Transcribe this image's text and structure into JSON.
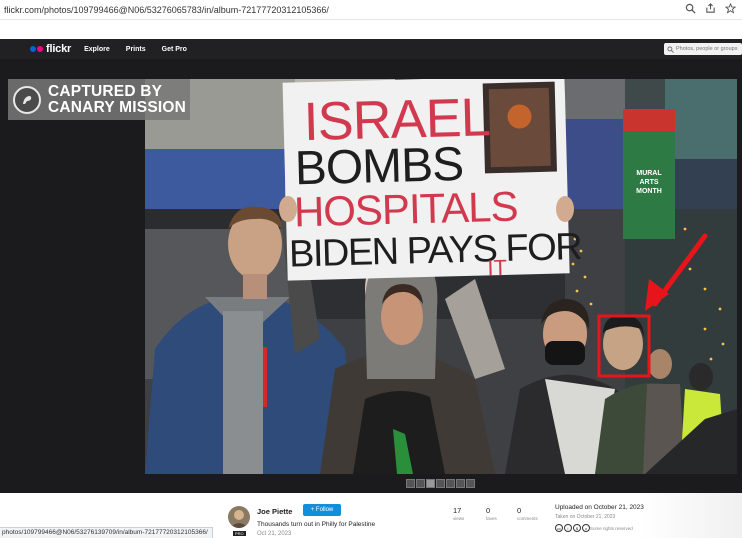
{
  "browser": {
    "url": "flickr.com/photos/109799466@N06/53276065783/in/album-72177720312105366/"
  },
  "nav": {
    "logo": "flickr",
    "links": [
      "Explore",
      "Prints",
      "Get Pro"
    ],
    "search_placeholder": "Photos, people or groups"
  },
  "watermark": {
    "line1": "CAPTURED BY",
    "line2": "CANARY MISSION"
  },
  "sign": {
    "line1": "ISRAEL",
    "line2": "BOMBS",
    "line3": "HOSPITALS",
    "line4": "BIDEN PAYS FOR",
    "line5": "IT"
  },
  "banner": {
    "line1": "MURAL",
    "line2": "ARTS",
    "line3": "MONTH"
  },
  "photo_info": {
    "author": "Joe Piette",
    "follow_label": "+ Follow",
    "pro_badge": "PRO",
    "title": "Thousands turn out in Philly for Palestine",
    "date": "Oct 21, 2023",
    "stats": [
      {
        "value": "17",
        "label": "views"
      },
      {
        "value": "0",
        "label": "faves"
      },
      {
        "value": "0",
        "label": "comments"
      }
    ],
    "uploaded": "Uploaded on October 21, 2023",
    "taken": "Taken on October 21, 2023",
    "rights": "Some rights reserved"
  },
  "status_url": "photos/109799466@N06/53276139709/in/album-72177720312105366/",
  "colors": {
    "nav_bg": "#212124",
    "stage_bg": "#1b1b1d",
    "flickr_blue": "#0063dc",
    "flickr_pink": "#ff0084",
    "follow_blue": "#128fdc",
    "annotation_red": "#e8141b"
  }
}
